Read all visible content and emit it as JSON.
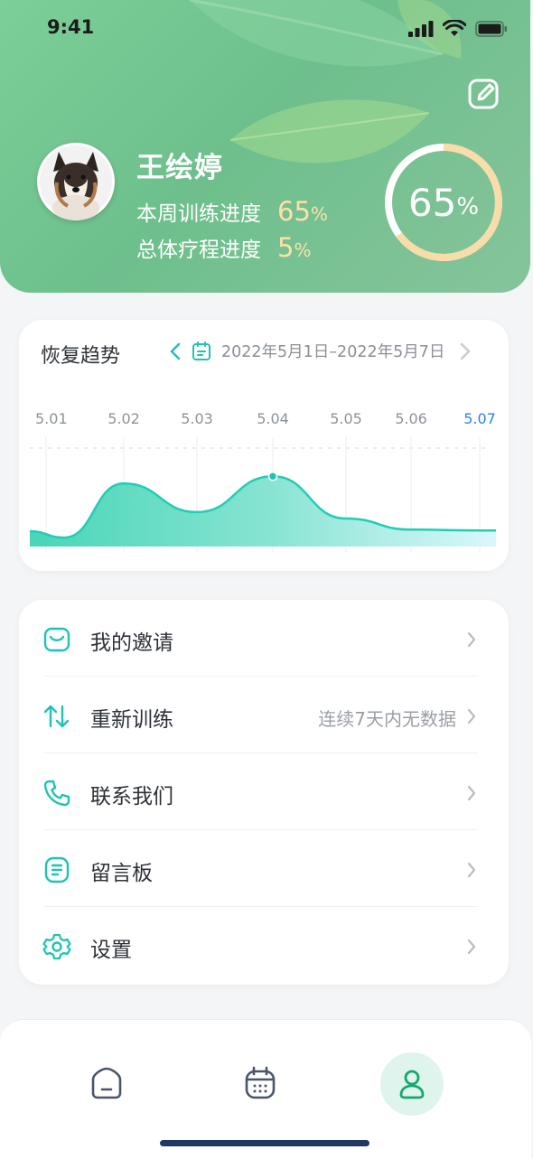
{
  "status_bar": {
    "time": "9:41"
  },
  "profile": {
    "name": "王绘婷",
    "weekly_label": "本周训练进度",
    "weekly_value": "65",
    "overall_label": "总体疗程进度",
    "overall_value": "5",
    "percent_sign": "%",
    "ring_value": "65",
    "ring_fraction": 0.65
  },
  "trend": {
    "title": "恢复趋势",
    "date_range": "2022年5月1日–2022年5月7日"
  },
  "chart_data": {
    "type": "area",
    "categories": [
      "5.01",
      "5.02",
      "5.03",
      "5.04",
      "5.05",
      "5.06",
      "5.07"
    ],
    "selected_category": "5.07",
    "highlighted_point": "5.04",
    "series": [
      {
        "values": [
          18,
          86,
          50,
          95,
          42,
          28,
          27
        ]
      }
    ],
    "ylim": [
      0,
      110
    ],
    "grid": true
  },
  "menu": {
    "items": [
      {
        "label": "我的邀请",
        "value": "",
        "icon": "mail-icon"
      },
      {
        "label": "重新训练",
        "value": "连续7天内无数据",
        "icon": "swap-arrows-icon"
      },
      {
        "label": "联系我们",
        "value": "",
        "icon": "phone-icon"
      },
      {
        "label": "留言板",
        "value": "",
        "icon": "message-board-icon"
      },
      {
        "label": "设置",
        "value": "",
        "icon": "gear-icon"
      }
    ]
  },
  "tabbar": {
    "tabs": [
      {
        "icon": "home-icon",
        "active": false
      },
      {
        "icon": "calendar-icon",
        "active": false
      },
      {
        "icon": "user-icon",
        "active": true
      }
    ]
  },
  "colors": {
    "header_green": "#7dcf98",
    "accent_teal": "#1ec3b3",
    "progress_highlight": "#ffe1a8",
    "selected_date_blue": "#2f7ff0"
  }
}
